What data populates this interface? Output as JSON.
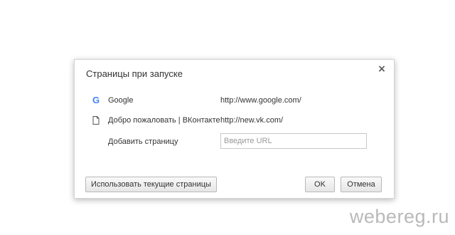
{
  "dialog": {
    "title": "Страницы при запуске",
    "close_label": "×",
    "pages": [
      {
        "icon": "google-g-icon",
        "name": "Google",
        "url": "http://www.google.com/"
      },
      {
        "icon": "document-icon",
        "name": "Добро пожаловать | ВКонтакте",
        "url": "http://new.vk.com/"
      }
    ],
    "add_page": {
      "label": "Добавить страницу",
      "placeholder": "Введите URL",
      "value": ""
    },
    "buttons": {
      "use_current": "Использовать текущие страницы",
      "ok": "OK",
      "cancel": "Отмена"
    }
  },
  "watermark": "webereg.ru",
  "colors": {
    "google_icon": "#4285f4",
    "dialog_border": "#d4d4d4",
    "text": "#333333",
    "watermark": "#b9b9b9"
  }
}
